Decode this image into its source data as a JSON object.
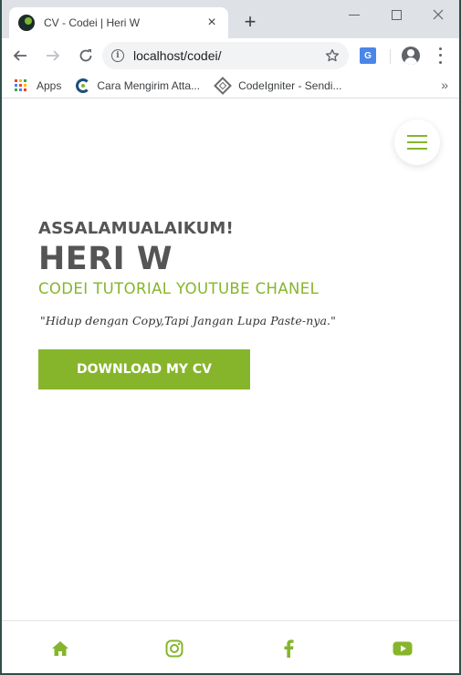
{
  "browser": {
    "tab_title": "CV - Codei | Heri W",
    "tab_close": "×",
    "new_tab": "+",
    "url": "localhost/codei/",
    "info_glyph": "i",
    "translate_glyph": "G",
    "bookmarks": [
      {
        "label": "Apps",
        "icon": "apps-grid-icon"
      },
      {
        "label": "Cara Mengirim Atta...",
        "icon": "codei-favicon-icon"
      },
      {
        "label": "CodeIgniter - Sendi...",
        "icon": "codeigniter-icon"
      }
    ],
    "bookmarks_more": "»"
  },
  "hero": {
    "greeting": "ASSALAMUALAIKUM!",
    "name": "HERI W",
    "subtitle": "CODEI TUTORIAL YOUTUBE CHANEL",
    "quote": "\"Hidup dengan Copy,Tapi Jangan Lupa Paste-nya.\"",
    "button_label": "DOWNLOAD MY CV"
  },
  "bottom_nav": [
    {
      "icon": "home-icon"
    },
    {
      "icon": "instagram-icon"
    },
    {
      "icon": "facebook-icon"
    },
    {
      "icon": "youtube-icon"
    }
  ],
  "colors": {
    "accent": "#86b52c",
    "heading": "#555555",
    "chrome_tabstrip": "#dee1e6",
    "omnibox": "#f1f3f4"
  }
}
